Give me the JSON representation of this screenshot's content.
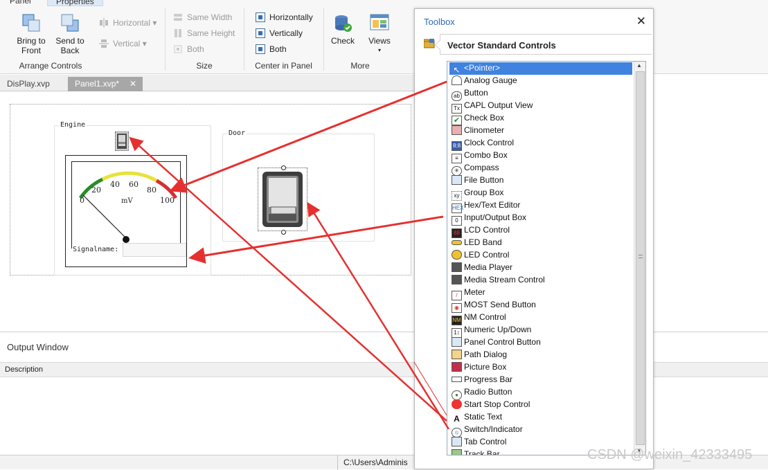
{
  "ribbon": {
    "tabs": [
      "Panel",
      "Properties"
    ],
    "bring_to_front": [
      "Bring to",
      "Front"
    ],
    "send_to_back": [
      "Send to",
      "Back"
    ],
    "horizontal": "Horizontal",
    "vertical": "Vertical",
    "arrange_label": "Arrange Controls",
    "same_width": "Same Width",
    "same_height": "Same Height",
    "both_size": "Both",
    "size_label": "Size",
    "center_horizontally": "Horizontally",
    "center_vertically": "Vertically",
    "center_both": "Both",
    "center_label": "Center in Panel",
    "check": "Check",
    "views": "Views",
    "more_label": "More"
  },
  "doc_tabs": {
    "tab1": "DisPlay.xvp",
    "tab2": "Panel1.xvp*",
    "close": "✕"
  },
  "panel": {
    "engine_label": "Engine",
    "door_label": "Door",
    "gauge_ticks": [
      "0",
      "20",
      "40",
      "60",
      "80",
      "100"
    ],
    "gauge_unit": "mV",
    "signal_label": "Signalname:"
  },
  "output": {
    "title": "Output Window",
    "description_header": "Description"
  },
  "statusbar": {
    "path": "C:\\Users\\Adminis"
  },
  "toolbox": {
    "title": "Toolbox",
    "close": "✕",
    "category": "Vector Standard Controls",
    "items": [
      "<Pointer>",
      "Analog Gauge",
      "Button",
      "CAPL Output View",
      "Check Box",
      "Clinometer",
      "Clock Control",
      "Combo Box",
      "Compass",
      "File Button",
      "Group Box",
      "Hex/Text Editor",
      "Input/Output Box",
      "LCD Control",
      "LED Band",
      "LED Control",
      "Media Player",
      "Media Stream Control",
      "Meter",
      "MOST Send Button",
      "NM Control",
      "Numeric Up/Down",
      "Panel Control Button",
      "Path Dialog",
      "Picture Box",
      "Progress Bar",
      "Radio Button",
      "Start Stop Control",
      "Static Text",
      "Switch/Indicator",
      "Tab Control",
      "Track Bar"
    ]
  },
  "watermark": "CSDN @weixin_42333495",
  "colors": {
    "accent": "#2b6cb8",
    "selection": "#3f82e0",
    "arrow": "#e53030"
  }
}
